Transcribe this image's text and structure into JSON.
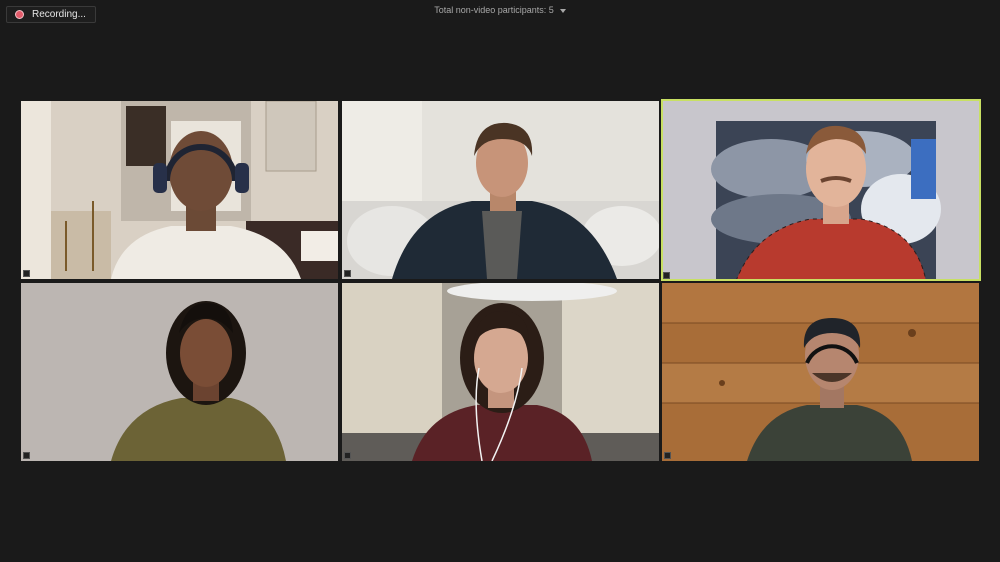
{
  "recording": {
    "label": "Recording...",
    "icon": "record-dot-icon"
  },
  "participants": {
    "summary": "Total non-video participants: 5",
    "icon": "chevron-down-icon"
  },
  "colors": {
    "background": "#1a1a1a",
    "active_speaker_border": "#c8e063",
    "record_dot": "#e25b6a"
  },
  "tiles": [
    {
      "name": "tile-1"
    },
    {
      "name": "tile-2"
    },
    {
      "name": "tile-3",
      "active_speaker": true
    },
    {
      "name": "tile-4"
    },
    {
      "name": "tile-5"
    },
    {
      "name": "tile-6"
    }
  ]
}
